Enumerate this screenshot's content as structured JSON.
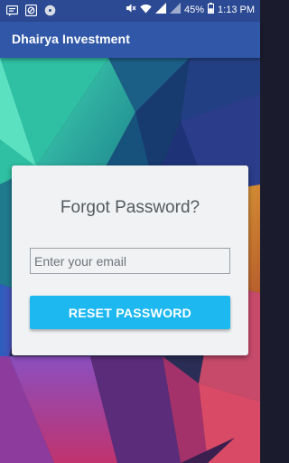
{
  "status_bar": {
    "icons": [
      "sms-icon",
      "block-icon",
      "cd-icon"
    ],
    "battery": "45%",
    "time": "1:13 PM"
  },
  "app_bar": {
    "title": "Dhairya Investment"
  },
  "form": {
    "title": "Forgot Password?",
    "email_placeholder": "Enter your email",
    "reset_label": "RESET PASSWORD"
  },
  "colors": {
    "status_bar": "#2c4a93",
    "app_bar": "#3157a8",
    "button": "#1eb8f1",
    "card": "#f0f2f4"
  }
}
